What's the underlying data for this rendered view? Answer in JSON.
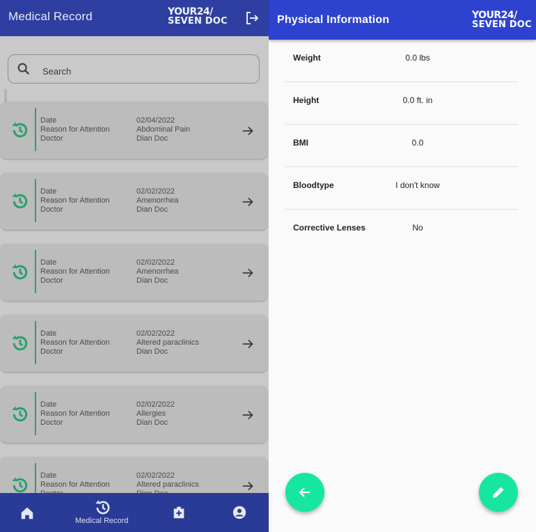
{
  "left_screen": {
    "title": "Medical Record",
    "logo": {
      "line1": "YOUR24/",
      "line2": "SEVEN DOC"
    },
    "search": {
      "placeholder": "Search"
    },
    "labels": {
      "date": "Date",
      "reason": "Reason for Attention",
      "doctor": "Doctor"
    },
    "records": [
      {
        "date": "02/04/2022",
        "reason": "Abdominal Pain",
        "doctor": "Dian Doc"
      },
      {
        "date": "02/02/2022",
        "reason": "Amenorrhea",
        "doctor": "Dian Doc"
      },
      {
        "date": "02/02/2022",
        "reason": "Amenorrhea",
        "doctor": "Dian Doc"
      },
      {
        "date": "02/02/2022",
        "reason": "Altered paraclinics",
        "doctor": "Dian Doc"
      },
      {
        "date": "02/02/2022",
        "reason": "Allergies",
        "doctor": "Dian Doc"
      },
      {
        "date": "02/02/2022",
        "reason": "Altered paraclinics",
        "doctor": "Dian Doc"
      }
    ],
    "bottom_nav": {
      "active_label": "Medical Record"
    }
  },
  "right_screen": {
    "title": "Physical Information",
    "logo": {
      "line1": "YOUR24/",
      "line2": "SEVEN DOC"
    },
    "fields": [
      {
        "label": "Weight",
        "value": "0.0 lbs"
      },
      {
        "label": "Height",
        "value": "0.0 ft.  in"
      },
      {
        "label": "BMI",
        "value": "0.0"
      },
      {
        "label": "Bloodtype",
        "value": "I don't know"
      },
      {
        "label": "Corrective Lenses",
        "value": "No"
      }
    ]
  },
  "colors": {
    "primary": "#2e3fa1",
    "accent": "#17e6a0",
    "history_icon": "#27a06d"
  },
  "icons": [
    "logout-icon",
    "search-icon",
    "history-icon",
    "arrow-right-icon",
    "home-icon",
    "medical-cross-icon",
    "account-icon",
    "arrow-left-icon",
    "pencil-icon"
  ]
}
